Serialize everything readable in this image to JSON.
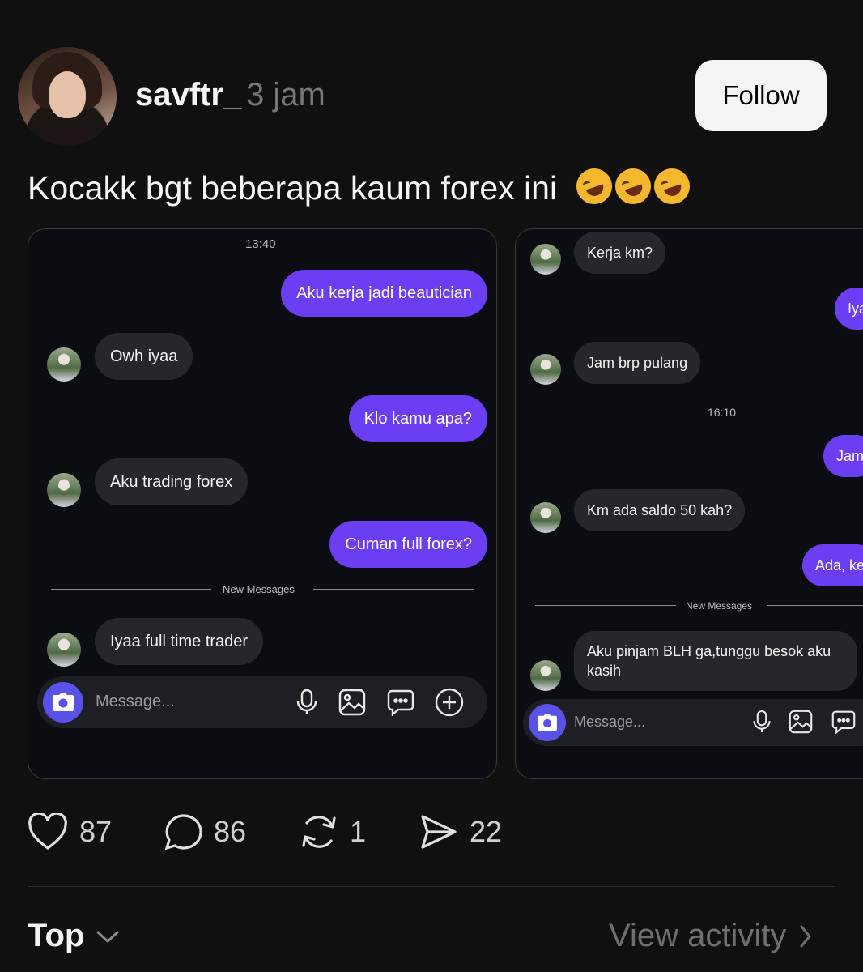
{
  "post": {
    "username": "savftr_",
    "time_ago": "3 jam",
    "follow_label": "Follow",
    "text": "Kocakk bgt beberapa kaum forex ini",
    "emoji": [
      "rolling-on-floor-laughing",
      "rolling-on-floor-laughing",
      "rolling-on-floor-laughing"
    ]
  },
  "screenshot1": {
    "timestamp": "13:40",
    "messages": [
      {
        "dir": "out",
        "text": "Aku kerja jadi beautician"
      },
      {
        "dir": "in",
        "text": "Owh iyaa"
      },
      {
        "dir": "out",
        "text": "Klo kamu apa?"
      },
      {
        "dir": "in",
        "text": "Aku trading forex"
      },
      {
        "dir": "out",
        "text": "Cuman full forex?"
      },
      {
        "dir": "in",
        "text": "Iyaa full time trader"
      }
    ],
    "divider_label": "New Messages",
    "composer_placeholder": "Message..."
  },
  "screenshot2": {
    "timestamp": "16:10",
    "messages": [
      {
        "dir": "in",
        "text": "Kerja km?"
      },
      {
        "dir": "out",
        "text": "Iya"
      },
      {
        "dir": "in",
        "text": "Jam brp pulang"
      },
      {
        "dir": "out",
        "text": "Jam"
      },
      {
        "dir": "in",
        "text": "Km ada saldo 50 kah?"
      },
      {
        "dir": "out",
        "text": "Ada, ke"
      },
      {
        "dir": "in",
        "text": "Aku pinjam BLH ga,tunggu besok aku kasih"
      }
    ],
    "divider_label": "New Messages",
    "composer_placeholder": "Message..."
  },
  "actions": {
    "likes": "87",
    "comments": "86",
    "reposts": "1",
    "shares": "22"
  },
  "footer": {
    "sort_label": "Top",
    "view_activity_label": "View activity"
  },
  "colors": {
    "accent_purple": "#6b3df3",
    "camera_button": "#5a52e8",
    "background": "#101010"
  }
}
